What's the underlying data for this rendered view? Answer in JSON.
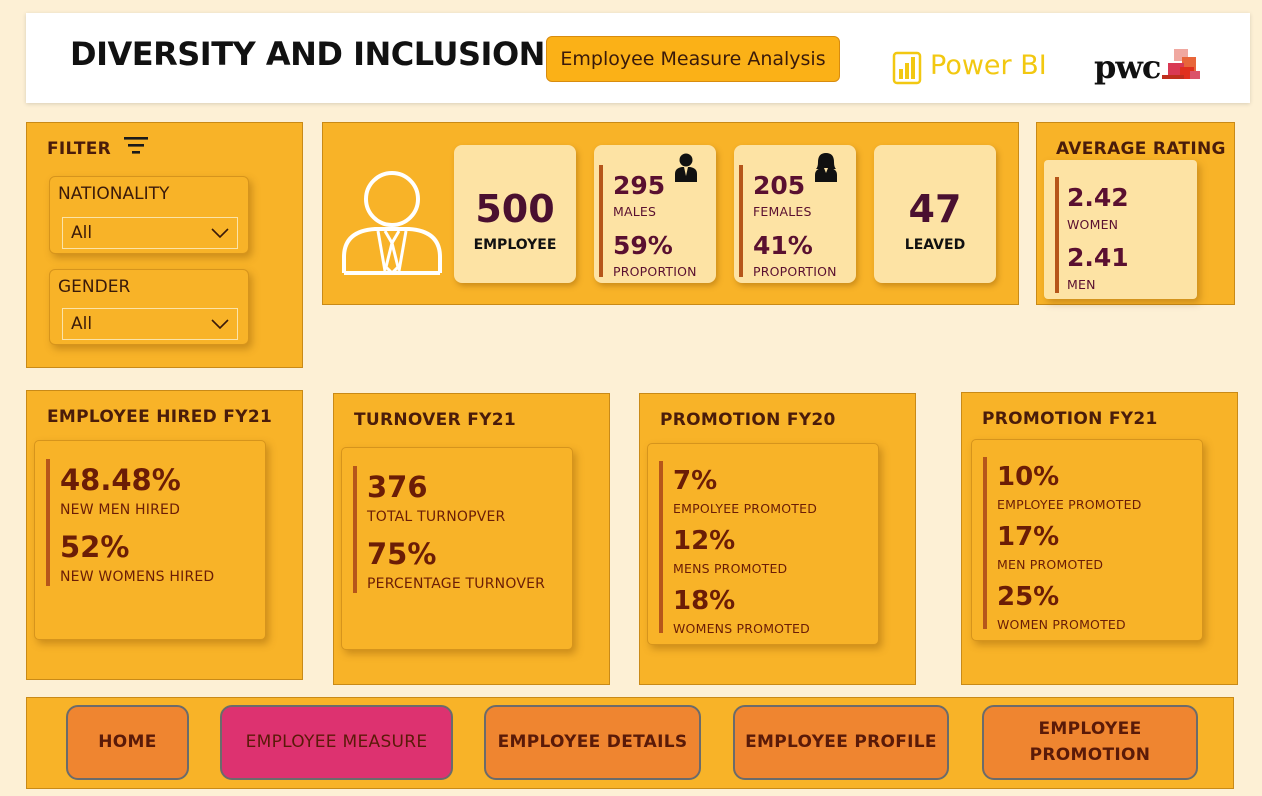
{
  "header": {
    "title": "DIVERSITY AND INCLUSION",
    "subtitle": "Employee Measure Analysis",
    "powerbi": "Power BI",
    "pwc": "pwc"
  },
  "filter": {
    "title": "FILTER",
    "nationality": {
      "label": "NATIONALITY",
      "value": "All"
    },
    "gender": {
      "label": "GENDER",
      "value": "All"
    }
  },
  "kpis": {
    "employee": {
      "value": "500",
      "label": "EMPLOYEE"
    },
    "males": {
      "value": "295",
      "label": "MALES",
      "proportion": "59%",
      "proportion_label": "PROPORTION"
    },
    "females": {
      "value": "205",
      "label": "FEMALES",
      "proportion": "41%",
      "proportion_label": "PROPORTION"
    },
    "leaved": {
      "value": "47",
      "label": "LEAVED"
    }
  },
  "average_rating": {
    "title": "AVERAGE RATING",
    "women": {
      "value": "2.42",
      "label": "WOMEN"
    },
    "men": {
      "value": "2.41",
      "label": "MEN"
    }
  },
  "hired": {
    "title": "EMPLOYEE HIRED FY21",
    "men": {
      "value": "48.48%",
      "label": "NEW MEN HIRED"
    },
    "women": {
      "value": "52%",
      "label": "NEW WOMENS HIRED"
    }
  },
  "turnover": {
    "title": "TURNOVER FY21",
    "total": {
      "value": "376",
      "label": "TOTAL TURNOPVER"
    },
    "pct": {
      "value": "75%",
      "label": "PERCENTAGE TURNOVER"
    }
  },
  "promotion_fy20": {
    "title": "PROMOTION FY20",
    "employee": {
      "value": "7%",
      "label": "EMPOLYEE PROMOTED"
    },
    "mens": {
      "value": "12%",
      "label": "MENS PROMOTED"
    },
    "womens": {
      "value": "18%",
      "label": "WOMENS PROMOTED"
    }
  },
  "promotion_fy21": {
    "title": "PROMOTION FY21",
    "employee": {
      "value": "10%",
      "label": "EMPLOYEE PROMOTED"
    },
    "men": {
      "value": "17%",
      "label": "MEN PROMOTED"
    },
    "women": {
      "value": "25%",
      "label": "WOMEN PROMOTED"
    }
  },
  "nav": {
    "home": "HOME",
    "employee_measure": "EMPLOYEE MEASURE",
    "employee_details": "EMPLOYEE DETAILS",
    "employee_profile": "EMPLOYEE PROFILE",
    "employee_promotion_1": "EMPLOYEE",
    "employee_promotion_2": "PROMOTION"
  },
  "colors": {
    "background": "#fdf0d5",
    "panel": "#f8b328",
    "kpi_card": "#fde3a4",
    "value_text": "#6b1d06",
    "nav_button": "#ef8530",
    "nav_active": "#dd3270"
  }
}
